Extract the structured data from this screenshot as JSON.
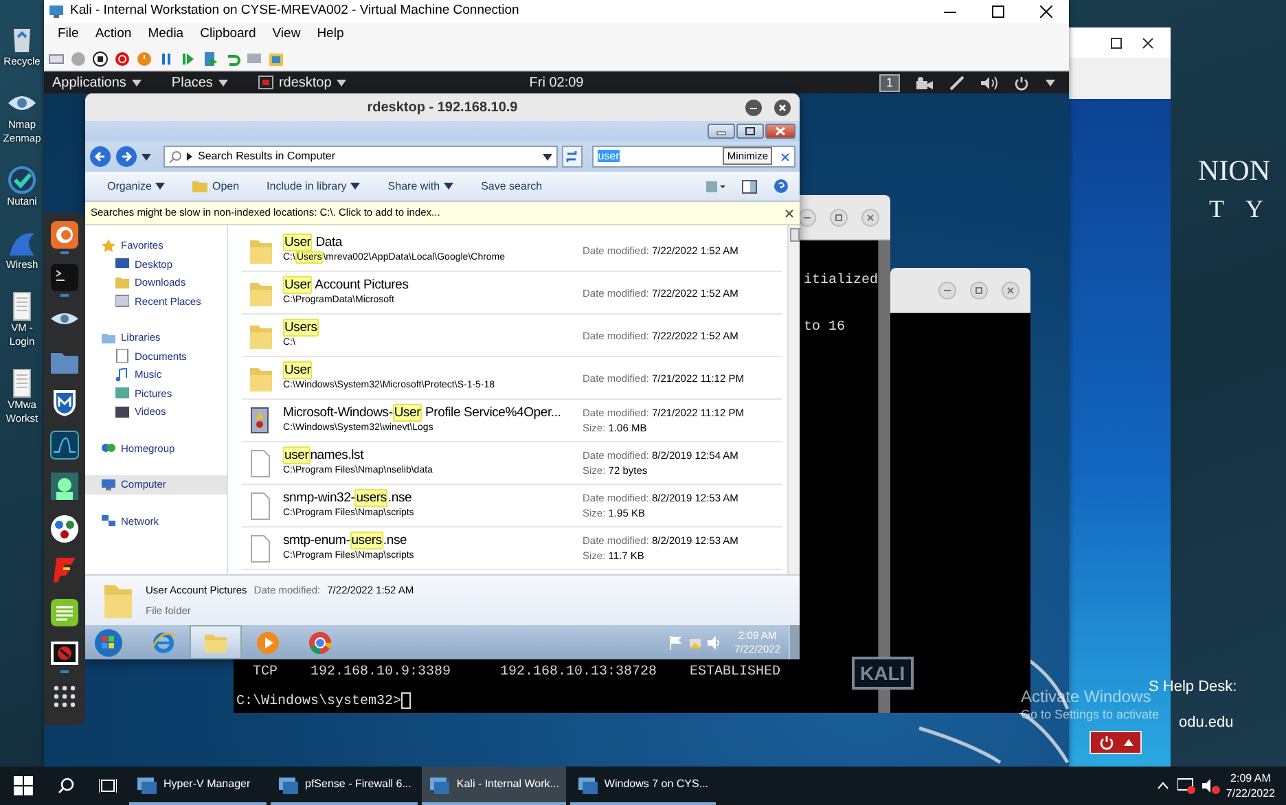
{
  "host_desktop": {
    "icons": [
      {
        "kind": "recycle",
        "labels": [
          "Recycle"
        ]
      },
      {
        "kind": "eye",
        "labels": [
          "Nmap",
          "Zenmap"
        ]
      },
      {
        "kind": "check",
        "labels": [
          "Nutani"
        ]
      },
      {
        "kind": "fin",
        "labels": [
          "Wiresh"
        ]
      },
      {
        "kind": "doc",
        "labels": [
          "VM -",
          "Login"
        ]
      },
      {
        "kind": "doc",
        "labels": [
          "VMwa",
          "Workst"
        ]
      }
    ]
  },
  "back_window": {
    "heading": "NION",
    "subheading": "T Y",
    "help_desk": "S Help Desk:",
    "domain": "odu.edu"
  },
  "vm_window": {
    "title": "Kali - Internal Workstation on CYSE-MREVA002 - Virtual Machine Connection",
    "menu": [
      "File",
      "Action",
      "Media",
      "Clipboard",
      "View",
      "Help"
    ],
    "kali": {
      "top_bar": {
        "menus": [
          "Applications",
          "Places",
          "rdesktop"
        ],
        "clock": "Fri 02:09",
        "workspace": "1"
      },
      "dock": [
        {
          "kind": "fox",
          "running": true
        },
        {
          "kind": "terminal",
          "running": true
        },
        {
          "kind": "eye",
          "running": false
        },
        {
          "kind": "folder",
          "running": false
        },
        {
          "kind": "shield",
          "running": false
        },
        {
          "kind": "wave",
          "running": false
        },
        {
          "kind": "avatar",
          "running": false
        },
        {
          "kind": "dots",
          "running": false
        },
        {
          "kind": "zigzag",
          "running": false
        },
        {
          "kind": "notes",
          "running": false
        },
        {
          "kind": "blocked",
          "running": true
        },
        {
          "kind": "grid",
          "running": false
        }
      ],
      "terminal": {
        "top_lines": [
          "itialized",
          "to 16"
        ],
        "bottom_lines": [
          "TCP    192.168.10.9:3389      192.168.10.13:38728    ESTABLISHED",
          "C:\\Windows\\system32>"
        ]
      },
      "logo_text": "KALI",
      "rdesktop": {
        "title": "rdesktop - 192.168.10.9",
        "explorer": {
          "tooltip": "Minimize",
          "address": "Search Results in Computer",
          "search": {
            "value": "user",
            "selected": true
          },
          "toolbar": [
            {
              "label": "Organize",
              "dropdown": true
            },
            {
              "label": "Open",
              "dropdown": false
            },
            {
              "label": "Include in library",
              "dropdown": true
            },
            {
              "label": "Share with",
              "dropdown": true
            },
            {
              "label": "Save search",
              "dropdown": false
            }
          ],
          "info_bar": "Searches might be slow in non-indexed locations: C:\\. Click to add to index...",
          "nav": [
            {
              "kind": "header",
              "label": "Favorites",
              "selected": false
            },
            {
              "kind": "item",
              "label": "Desktop",
              "selected": false
            },
            {
              "kind": "item",
              "label": "Downloads",
              "selected": false
            },
            {
              "kind": "item",
              "label": "Recent Places",
              "selected": false
            },
            {
              "kind": "header",
              "label": "Libraries",
              "selected": false
            },
            {
              "kind": "item",
              "label": "Documents",
              "selected": false
            },
            {
              "kind": "item",
              "label": "Music",
              "selected": false
            },
            {
              "kind": "item",
              "label": "Pictures",
              "selected": false
            },
            {
              "kind": "item",
              "label": "Videos",
              "selected": false
            },
            {
              "kind": "header",
              "label": "Homegroup",
              "selected": false
            },
            {
              "kind": "header",
              "label": "Computer",
              "selected": true
            },
            {
              "kind": "header",
              "label": "Network",
              "selected": false
            }
          ],
          "results": [
            {
              "kind": "folder",
              "name": [
                {
                  "text": "User",
                  "hit": true
                },
                {
                  "text": " Data",
                  "hit": false
                }
              ],
              "path": [
                {
                  "text": "C:\\",
                  "hit": false
                },
                {
                  "text": "Users",
                  "hit": true
                },
                {
                  "text": "\\mreva002\\AppData\\Local\\Google\\Chrome",
                  "hit": false
                }
              ],
              "date_label": "Date modified:",
              "date": "7/22/2022 1:52 AM"
            },
            {
              "kind": "folder",
              "name": [
                {
                  "text": "User",
                  "hit": true
                },
                {
                  "text": " Account Pictures",
                  "hit": false
                }
              ],
              "path": [
                {
                  "text": "C:\\ProgramData\\Microsoft",
                  "hit": false
                }
              ],
              "date_label": "Date modified:",
              "date": "7/22/2022 1:52 AM"
            },
            {
              "kind": "folder",
              "name": [
                {
                  "text": "Users",
                  "hit": true
                }
              ],
              "path": [
                {
                  "text": "C:\\",
                  "hit": false
                }
              ],
              "date_label": "Date modified:",
              "date": "7/22/2022 1:52 AM"
            },
            {
              "kind": "folder",
              "name": [
                {
                  "text": "User",
                  "hit": true
                }
              ],
              "path": [
                {
                  "text": "C:\\Windows\\System32\\Microsoft\\Protect\\S-1-5-18",
                  "hit": false
                }
              ],
              "date_label": "Date modified:",
              "date": "7/21/2022 11:12 PM"
            },
            {
              "kind": "log",
              "name": [
                {
                  "text": "Microsoft-Windows-",
                  "hit": false
                },
                {
                  "text": "User",
                  "hit": true
                },
                {
                  "text": " Profile Service%4Oper...",
                  "hit": false
                }
              ],
              "path": [
                {
                  "text": "C:\\Windows\\System32\\winevt\\Logs",
                  "hit": false
                }
              ],
              "date_label": "Date modified:",
              "date": "7/21/2022 11:12 PM",
              "size_label": "Size:",
              "size": "1.06 MB"
            },
            {
              "kind": "file",
              "name": [
                {
                  "text": "user",
                  "hit": true
                },
                {
                  "text": "names.lst",
                  "hit": false
                }
              ],
              "path": [
                {
                  "text": "C:\\Program Files\\Nmap\\nselib\\data",
                  "hit": false
                }
              ],
              "date_label": "Date modified:",
              "date": "8/2/2019 12:54 AM",
              "size_label": "Size:",
              "size": "72 bytes"
            },
            {
              "kind": "file",
              "name": [
                {
                  "text": "snmp-win32-",
                  "hit": false
                },
                {
                  "text": "users",
                  "hit": true
                },
                {
                  "text": ".nse",
                  "hit": false
                }
              ],
              "path": [
                {
                  "text": "C:\\Program Files\\Nmap\\scripts",
                  "hit": false
                }
              ],
              "date_label": "Date modified:",
              "date": "8/2/2019 12:53 AM",
              "size_label": "Size:",
              "size": "1.95 KB"
            },
            {
              "kind": "file",
              "name": [
                {
                  "text": "smtp-enum-",
                  "hit": false
                },
                {
                  "text": "users",
                  "hit": true
                },
                {
                  "text": ".nse",
                  "hit": false
                }
              ],
              "path": [
                {
                  "text": "C:\\Program Files\\Nmap\\scripts",
                  "hit": false
                }
              ],
              "date_label": "Date modified:",
              "date": "8/2/2019 12:53 AM",
              "size_label": "Size:",
              "size": "11.7 KB"
            }
          ],
          "details": {
            "name": "User Account Pictures",
            "date_label": "Date modified:",
            "date": "7/22/2022 1:52 AM",
            "type": "File folder"
          },
          "taskbar": {
            "apps": [
              {
                "kind": "ie",
                "active": false
              },
              {
                "kind": "explorer",
                "active": true
              },
              {
                "kind": "media",
                "active": false
              },
              {
                "kind": "chrome",
                "active": false
              }
            ],
            "time": "2:09 AM",
            "date": "7/22/2022"
          }
        }
      }
    }
  },
  "activation": {
    "title": "Activate Windows",
    "text": "Go to Settings to activate"
  },
  "taskbar": {
    "items": [
      {
        "label": "Hyper-V Manager",
        "active": false
      },
      {
        "label": "pfSense - Firewall 6...",
        "active": false
      },
      {
        "label": "Kali - Internal Work...",
        "active": true
      },
      {
        "label": "Windows 7 on CYS...",
        "active": false
      }
    ],
    "time": "2:09 AM",
    "date": "7/22/2022"
  }
}
